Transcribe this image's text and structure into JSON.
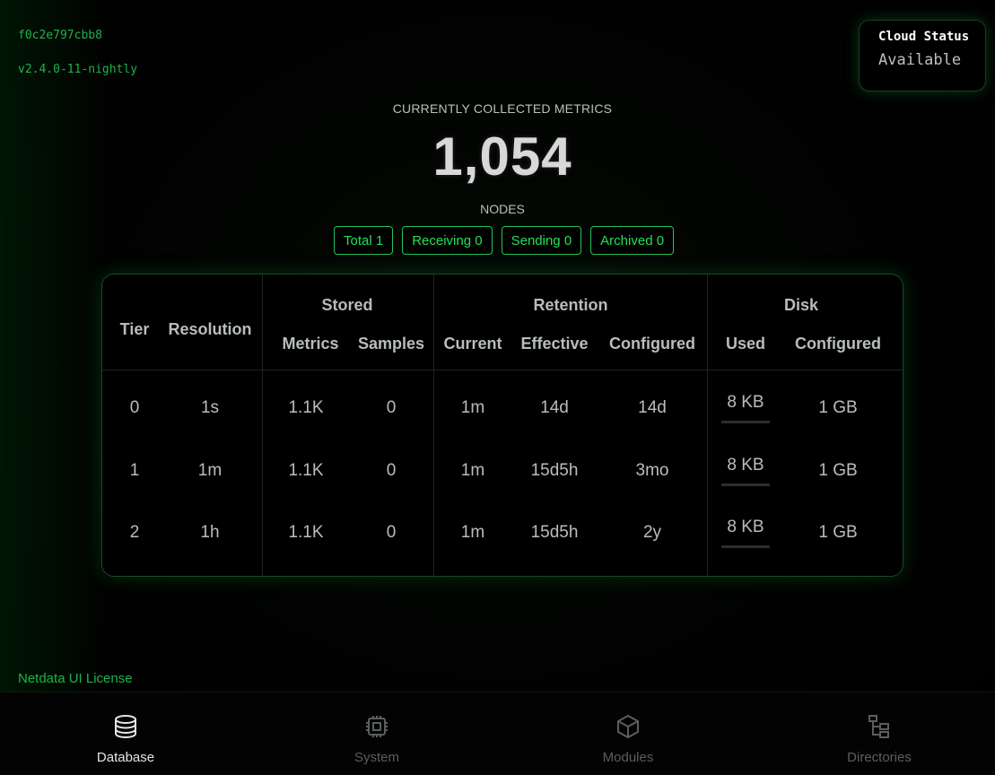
{
  "build": {
    "hash": "f0c2e797cbb8",
    "version": "v2.4.0-11-nightly"
  },
  "cloud": {
    "title": "Cloud Status",
    "status": "Available"
  },
  "metrics": {
    "caption": "CURRENTLY COLLECTED METRICS",
    "count": "1,054"
  },
  "nodes": {
    "caption": "NODES",
    "chips": [
      {
        "label": "Total",
        "value": "1"
      },
      {
        "label": "Receiving",
        "value": "0"
      },
      {
        "label": "Sending",
        "value": "0"
      },
      {
        "label": "Archived",
        "value": "0"
      }
    ]
  },
  "table": {
    "groups": {
      "stored": "Stored",
      "retention": "Retention",
      "disk": "Disk"
    },
    "columns": {
      "tier": "Tier",
      "resolution": "Resolution",
      "metrics": "Metrics",
      "samples": "Samples",
      "current": "Current",
      "effective": "Effective",
      "configured": "Configured",
      "used": "Used",
      "disk_configured": "Configured"
    },
    "rows": [
      {
        "tier": "0",
        "resolution": "1s",
        "metrics": "1.1K",
        "samples": "0",
        "current": "1m",
        "effective": "14d",
        "configured": "14d",
        "used": "8 KB",
        "disk_configured": "1 GB"
      },
      {
        "tier": "1",
        "resolution": "1m",
        "metrics": "1.1K",
        "samples": "0",
        "current": "1m",
        "effective": "15d5h",
        "configured": "3mo",
        "used": "8 KB",
        "disk_configured": "1 GB"
      },
      {
        "tier": "2",
        "resolution": "1h",
        "metrics": "1.1K",
        "samples": "0",
        "current": "1m",
        "effective": "15d5h",
        "configured": "2y",
        "used": "8 KB",
        "disk_configured": "1 GB"
      }
    ]
  },
  "license": "Netdata UI License",
  "nav": [
    {
      "label": "Database",
      "icon": "database-icon",
      "active": true
    },
    {
      "label": "System",
      "icon": "chip-icon",
      "active": false
    },
    {
      "label": "Modules",
      "icon": "cube-icon",
      "active": false
    },
    {
      "label": "Directories",
      "icon": "folder-tree-icon",
      "active": false
    }
  ],
  "colors": {
    "accent": "#22c55e",
    "text": "#bcbcbc",
    "background": "#000000"
  }
}
